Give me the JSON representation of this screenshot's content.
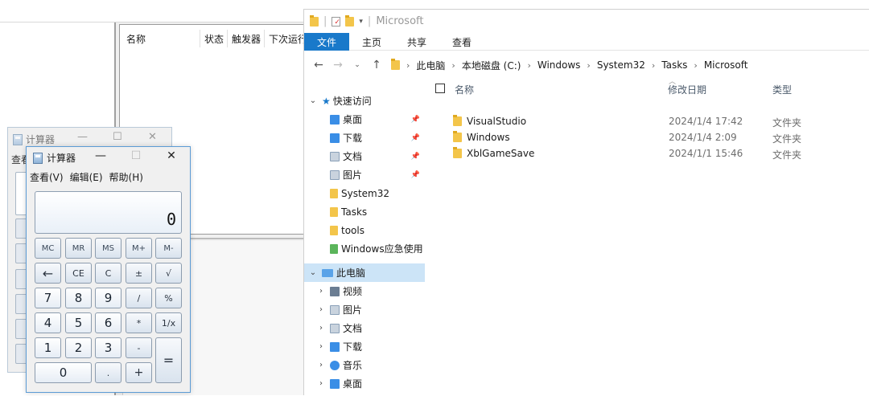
{
  "task_scheduler": {
    "columns": [
      "名称",
      "状态",
      "触发器",
      "下次运行"
    ]
  },
  "calculator_back": {
    "title": "计算器",
    "menu_first": "查看"
  },
  "calculator": {
    "title": "计算器",
    "menu": [
      "查看(V)",
      "编辑(E)",
      "帮助(H)"
    ],
    "display": "0",
    "memory_row": [
      "MC",
      "MR",
      "MS",
      "M+",
      "M-"
    ],
    "row2": [
      "←",
      "CE",
      "C",
      "±",
      "√"
    ],
    "row3": [
      "7",
      "8",
      "9",
      "/",
      "%"
    ],
    "row4": [
      "4",
      "5",
      "6",
      "*",
      "1/x"
    ],
    "row5": [
      "1",
      "2",
      "3",
      "-"
    ],
    "row6": [
      "0",
      ".",
      "+"
    ],
    "equals": "="
  },
  "explorer": {
    "window_title": "Microsoft",
    "ribbon_tabs": [
      "文件",
      "主页",
      "共享",
      "查看"
    ],
    "breadcrumb": [
      "此电脑",
      "本地磁盘 (C:)",
      "Windows",
      "System32",
      "Tasks",
      "Microsoft"
    ],
    "nav": {
      "quick_access": "快速访问",
      "pinned": [
        "桌面",
        "下载",
        "文档",
        "图片"
      ],
      "folders": [
        "System32",
        "Tasks",
        "tools",
        "Windows应急使用"
      ],
      "this_pc": "此电脑",
      "pc_items": [
        "视频",
        "图片",
        "文档",
        "下载",
        "音乐",
        "桌面"
      ]
    },
    "columns": {
      "name": "名称",
      "date": "修改日期",
      "type": "类型"
    },
    "files": [
      {
        "name": "VisualStudio",
        "date": "2024/1/4 17:42",
        "type": "文件夹"
      },
      {
        "name": "Windows",
        "date": "2024/1/4 2:09",
        "type": "文件夹"
      },
      {
        "name": "XblGameSave",
        "date": "2024/1/1 15:46",
        "type": "文件夹"
      }
    ]
  },
  "colors": {
    "accent": "#1979ca",
    "folder": "#f3c54a",
    "selection": "#cce4f7"
  }
}
